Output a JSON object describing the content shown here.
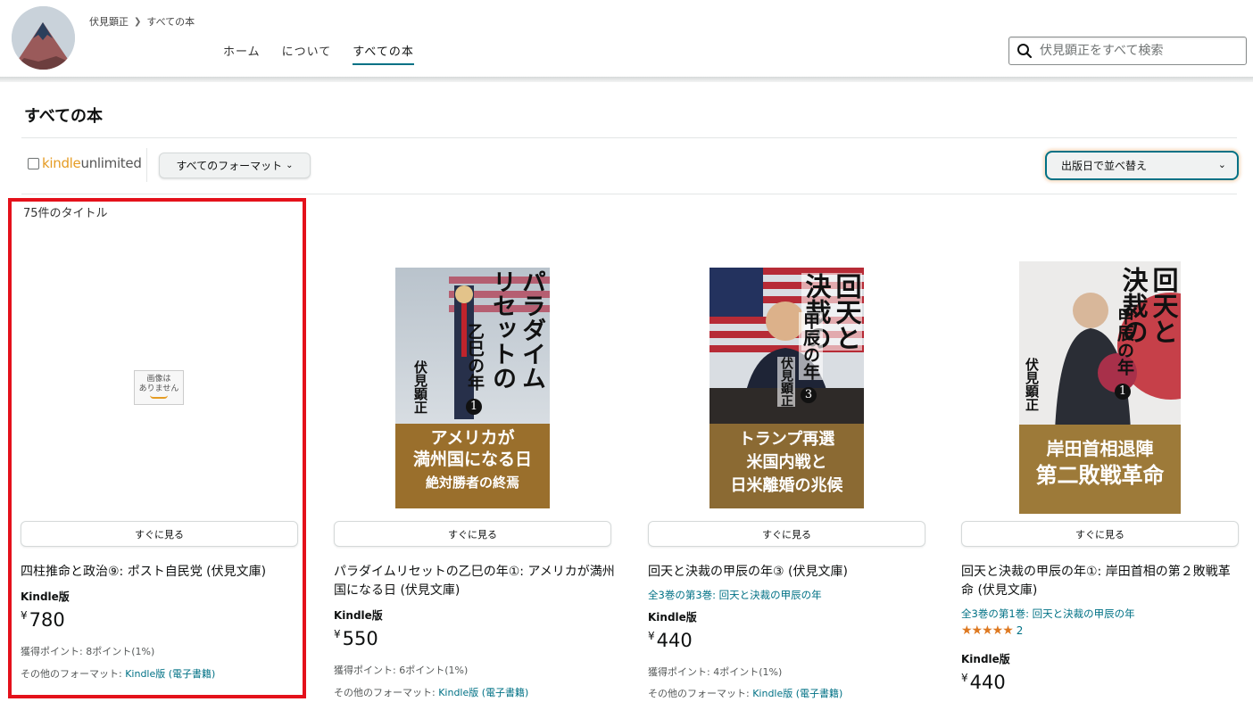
{
  "header": {
    "breadcrumb": [
      "伏見顕正",
      "すべての本"
    ],
    "nav": [
      "ホーム",
      "について",
      "すべての本"
    ],
    "search_placeholder": "伏見顕正をすべて検索"
  },
  "page": {
    "title": "すべての本",
    "kindle_unlimited": {
      "k": "kindle",
      "u": "unlimited"
    },
    "format_filter": "すべてのフォーマット",
    "sort": "出版日で並べ替え",
    "count": "75件のタイトル"
  },
  "books": [
    {
      "title": "四柱推命と政治⑨: ポスト自民党 (伏見文庫)",
      "cover_placeholder": [
        "画像は",
        "ありません"
      ],
      "see_button": "すぐに見る",
      "series": "",
      "format": "Kindle版",
      "yen": "¥",
      "price": "780",
      "points": "獲得ポイント: 8ポイント(1%)",
      "other_label": "その他のフォーマット: ",
      "other_link": "Kindle版 (電子書籍)"
    },
    {
      "title": "パラダイムリセットの乙巳の年①: アメリカが満州国になる日 (伏見文庫)",
      "cover_title": [
        "パラダイム",
        "リセットの"
      ],
      "cover_sub": "乙巳の年",
      "cover_num": "1",
      "cover_author": "伏見顕正",
      "cover_band": [
        "アメリカが",
        "満州国になる日",
        "絶対勝者の終焉"
      ],
      "see_button": "すぐに見る",
      "series": "",
      "format": "Kindle版",
      "yen": "¥",
      "price": "550",
      "points": "獲得ポイント: 6ポイント(1%)",
      "other_label": "その他のフォーマット: ",
      "other_link": "Kindle版 (電子書籍)"
    },
    {
      "title": "回天と決裁の甲辰の年③ (伏見文庫)",
      "cover_title": [
        "回天と",
        "決裁の"
      ],
      "cover_sub": "甲辰の年",
      "cover_num": "3",
      "cover_author": "伏見顕正",
      "cover_band": [
        "トランプ再選",
        "米国内戦と",
        "日米離婚の兆候"
      ],
      "see_button": "すぐに見る",
      "series": "全3巻の第3巻: 回天と決裁の甲辰の年",
      "format": "Kindle版",
      "yen": "¥",
      "price": "440",
      "points": "獲得ポイント: 4ポイント(1%)",
      "other_label": "その他のフォーマット: ",
      "other_link": "Kindle版 (電子書籍)"
    },
    {
      "title": "回天と決裁の甲辰の年①: 岸田首相の第２敗戦革命 (伏見文庫)",
      "cover_title": [
        "回天と",
        "決裁の"
      ],
      "cover_sub": "甲辰の年",
      "cover_num": "1",
      "cover_author": "伏見顕正",
      "cover_band": [
        "岸田首相退陣",
        "第二敗戦革命"
      ],
      "see_button": "すぐに見る",
      "series": "全3巻の第1巻: 回天と決裁の甲辰の年",
      "rating_count": "2",
      "rating_stars": 5,
      "format": "Kindle版",
      "yen": "¥",
      "price": "440"
    }
  ],
  "colors": {
    "accent": "#007185",
    "highlight": "#e4111b",
    "kindle_orange": "#e59c24"
  }
}
